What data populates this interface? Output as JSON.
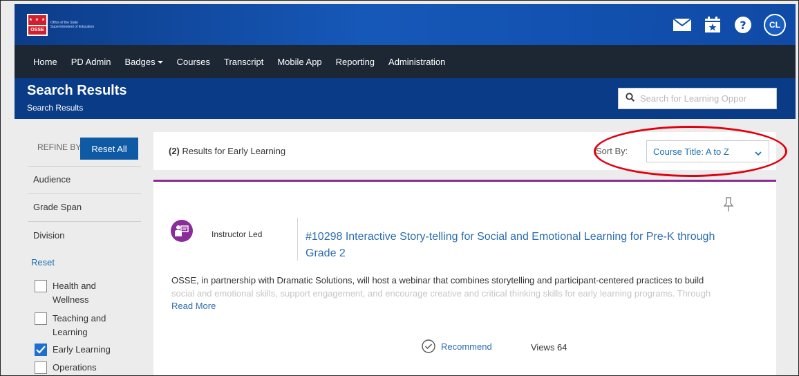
{
  "header": {
    "logo_text": "Office of the State Superintendent of Education",
    "logo_abbr": "OSSE",
    "user_initials": "CL"
  },
  "nav": {
    "items": [
      "Home",
      "PD Admin",
      "Badges",
      "Courses",
      "Transcript",
      "Mobile App",
      "Reporting",
      "Administration"
    ]
  },
  "page": {
    "title": "Search Results",
    "breadcrumb": "Search Results",
    "search_placeholder": "Search for Learning Oppor"
  },
  "sidebar": {
    "refine_label": "REFINE BY",
    "reset_all_label": "Reset All",
    "facets": [
      "Audience",
      "Grade Span",
      "Division"
    ],
    "reset_label": "Reset",
    "options": [
      {
        "label": "Health and Wellness",
        "checked": false
      },
      {
        "label": "Teaching and Learning",
        "checked": false
      },
      {
        "label": "Early Learning",
        "checked": true
      },
      {
        "label": "Operations",
        "checked": false
      }
    ]
  },
  "results": {
    "count": "(2)",
    "query_text": "Results for Early Learning",
    "sort_label": "Sort By:",
    "sort_value": "Course Title: A to Z"
  },
  "card": {
    "type": "Instructor Led",
    "title": "#10298 Interactive Story-telling for Social and Emotional Learning for Pre-K through Grade 2",
    "description_line1": "OSSE, in partnership with Dramatic Solutions, will host a webinar that combines storytelling and participant-centered practices to build",
    "description_line2": "social and emotional skills, support engagement, and encourage creative and critical thinking skills for early learning programs. Through",
    "read_more": "Read More",
    "recommend": "Recommend",
    "views": "Views 64"
  },
  "colors": {
    "header_blue": "#0f4aa6",
    "nav_dark": "#1c2733",
    "band_blue": "#093b86",
    "accent_purple": "#8a2c93",
    "annotation_red": "#e00010"
  }
}
